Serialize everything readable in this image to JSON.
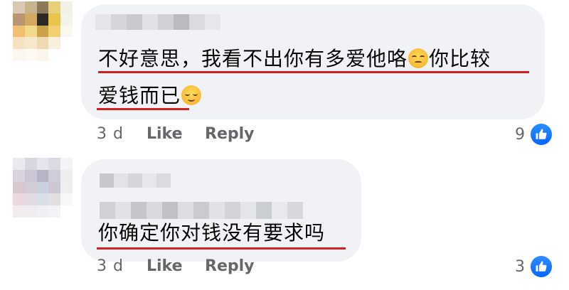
{
  "comments": [
    {
      "lines": [
        "不好意思，我看不出你有多爱他咯",
        "你比较",
        "爱钱而已"
      ],
      "emoji": [
        "unamused-face-icon",
        "relieved-face-icon"
      ],
      "time": "3 d",
      "like_label": "Like",
      "reply_label": "Reply",
      "reaction_count": "9"
    },
    {
      "lines": [
        "你确定你对钱没有要求吗"
      ],
      "time": "3 d",
      "like_label": "Like",
      "reply_label": "Reply",
      "reaction_count": "3"
    }
  ],
  "colors": {
    "bubble": "#f0f2f5",
    "underline": "#d21e1e",
    "meta_text": "#65676b",
    "like_blue": "#0866ff"
  }
}
